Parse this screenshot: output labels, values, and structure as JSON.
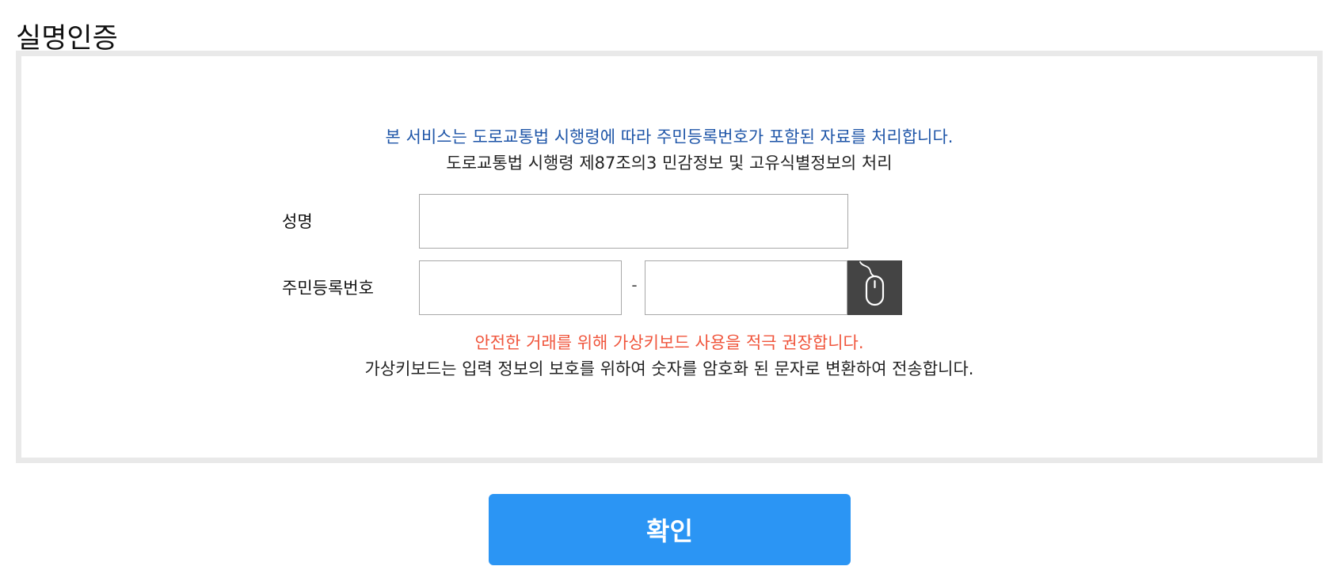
{
  "page": {
    "title": "실명인증"
  },
  "notice": {
    "primary": "본 서비스는 도로교통법 시행령에 따라 주민등록번호가 포함된 자료를 처리합니다.",
    "secondary": "도로교통법 시행령 제87조의3 민감정보 및 고유식별정보의 처리"
  },
  "form": {
    "name_label": "성명",
    "name_value": "",
    "rrn_label": "주민등록번호",
    "rrn_front_value": "",
    "rrn_separator": "-",
    "rrn_back_value": "",
    "virtual_keyboard_icon": "mouse-icon"
  },
  "warning": {
    "primary": "안전한 거래를 위해 가상키보드 사용을 적극 권장합니다.",
    "secondary": "가상키보드는 입력 정보의 보호를 위하여 숫자를 암호화 된 문자로 변환하여 전송합니다."
  },
  "actions": {
    "confirm_label": "확인"
  },
  "colors": {
    "notice_blue": "#1f56a8",
    "warning_red": "#f0553c",
    "confirm_button": "#2b95f4",
    "keyboard_button": "#444444",
    "panel_border": "#e9e9e9"
  }
}
